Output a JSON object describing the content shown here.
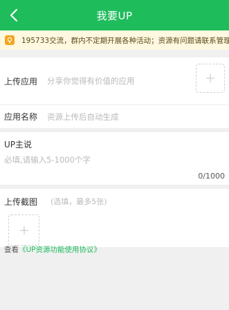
{
  "header": {
    "title": "我要UP",
    "back_icon": "back-chevron-icon",
    "background_color": "#1fbc5c"
  },
  "notice": {
    "icon": "bulb-icon",
    "text": "195733交流，群内不定期开展各种活动；资源有问题请联系管理员QQ",
    "background_color": "#fff8e0",
    "icon_color": "#f3a521"
  },
  "form": {
    "upload_app": {
      "label": "上传应用",
      "placeholder": "分享你觉得有价值的应用",
      "add_icon": "plus-icon"
    },
    "app_name": {
      "label": "应用名称",
      "placeholder": "资源上传后自动生成"
    },
    "description": {
      "label": "UP主说",
      "placeholder": "必填,请输入5-1000个字",
      "counter": "0/1000"
    },
    "screenshots": {
      "label": "上传截图",
      "hint": "(选填，最多5张)",
      "add_icon": "plus-icon"
    }
  },
  "agreement": {
    "prefix": "查看",
    "link": "《UP资源功能使用协议》",
    "link_color": "#1fbc5c"
  }
}
